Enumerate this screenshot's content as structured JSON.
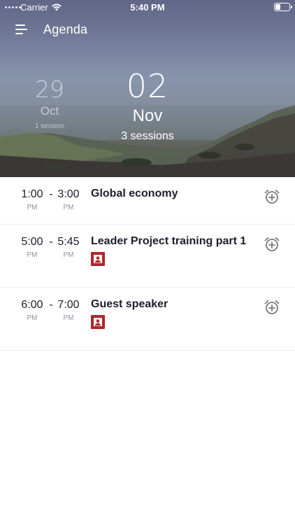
{
  "status_bar": {
    "carrier": "Carrier",
    "time": "5:40 PM",
    "battery_level": 0.35
  },
  "nav": {
    "title": "Agenda",
    "menu_icon": "menu-icon"
  },
  "dates": {
    "previous": {
      "day": "29",
      "month": "Oct",
      "sessions": "1 session"
    },
    "current": {
      "day": "02",
      "month": "Nov",
      "sessions": "3 sessions"
    }
  },
  "sessions": [
    {
      "start": "1:00",
      "start_ampm": "PM",
      "separator": "-",
      "end": "3:00",
      "end_ampm": "PM",
      "title": "Global economy",
      "has_speaker": false
    },
    {
      "start": "5:00",
      "start_ampm": "PM",
      "separator": "-",
      "end": "5:45",
      "end_ampm": "PM",
      "title": "Leader Project training part 1",
      "has_speaker": true
    },
    {
      "start": "6:00",
      "start_ampm": "PM",
      "separator": "-",
      "end": "7:00",
      "end_ampm": "PM",
      "title": "Guest speaker",
      "has_speaker": true
    }
  ],
  "colors": {
    "speaker_badge": "#b0272b",
    "text_primary": "#1f1d2b",
    "text_muted": "#8a93a3",
    "icon_gray": "#7a7a7a"
  },
  "icons": {
    "alarm": "alarm-add-icon",
    "speaker": "person-icon",
    "wifi": "wifi-icon"
  }
}
